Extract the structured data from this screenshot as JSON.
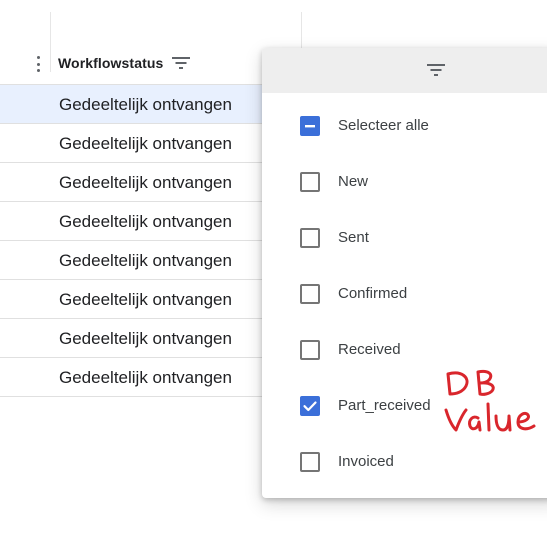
{
  "grid": {
    "column_title": "Workflowstatus",
    "rows": [
      {
        "status": "Gedeeltelijk ontvangen",
        "selected": true
      },
      {
        "status": "Gedeeltelijk ontvangen",
        "selected": false
      },
      {
        "status": "Gedeeltelijk ontvangen",
        "selected": false
      },
      {
        "status": "Gedeeltelijk ontvangen",
        "selected": false
      },
      {
        "status": "Gedeeltelijk ontvangen",
        "selected": false
      },
      {
        "status": "Gedeeltelijk ontvangen",
        "selected": false
      },
      {
        "status": "Gedeeltelijk ontvangen",
        "selected": false
      },
      {
        "status": "Gedeeltelijk ontvangen",
        "selected": false
      }
    ],
    "selected_row_color": "#e8f0fe"
  },
  "filter_popup": {
    "options": [
      {
        "label": "Selecteer alle",
        "state": "indeterminate"
      },
      {
        "label": "New",
        "state": "unchecked"
      },
      {
        "label": "Sent",
        "state": "unchecked"
      },
      {
        "label": "Confirmed",
        "state": "unchecked"
      },
      {
        "label": "Received",
        "state": "unchecked"
      },
      {
        "label": "Part_received",
        "state": "checked"
      },
      {
        "label": "Invoiced",
        "state": "unchecked"
      }
    ],
    "checkbox_accent": "#3b6fd9"
  },
  "annotation": {
    "lines": [
      "DB",
      "value"
    ],
    "ink_color": "#d9262c"
  },
  "icons": {
    "header_menu": "kebab-icon",
    "header_filter": "filter-icon",
    "popup_filter": "filter-icon",
    "check": "checkmark-icon",
    "indeterminate": "dash-icon"
  }
}
